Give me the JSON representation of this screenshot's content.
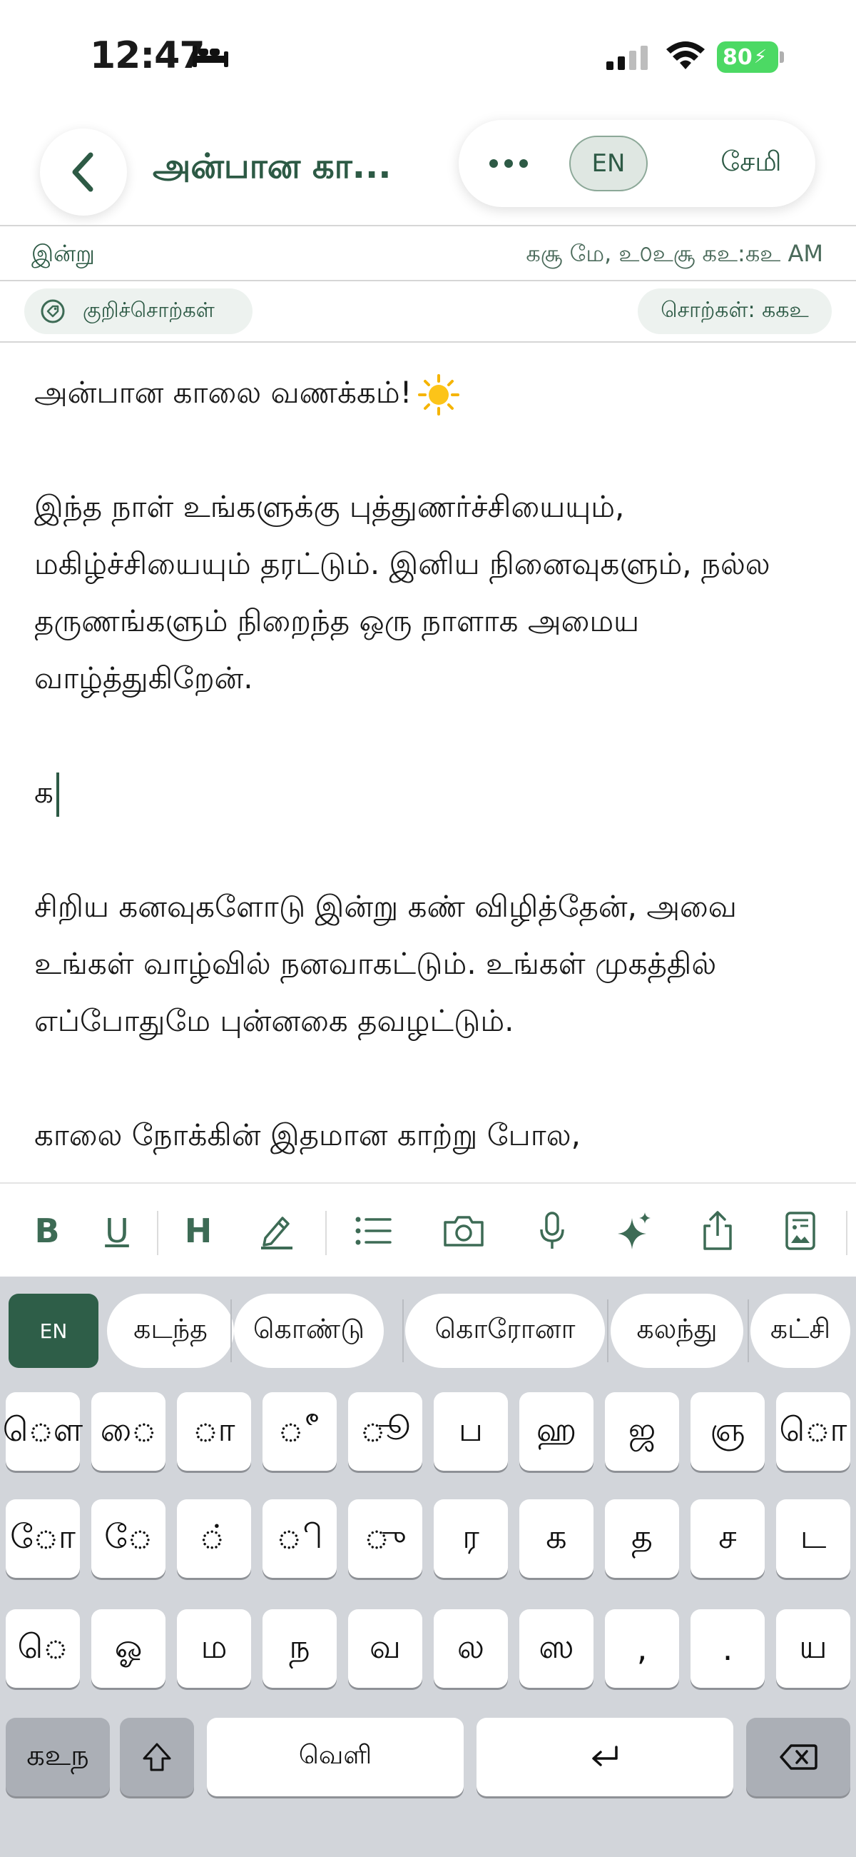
{
  "status_bar": {
    "time": "12:47",
    "battery": "80"
  },
  "nav": {
    "title": "அன்பான கா...",
    "lang": "EN",
    "save": "சேமி"
  },
  "meta": {
    "date_label": "இன்று",
    "datetime": "கசூ மே, உ௦உசூ கஉ:கஉ AM"
  },
  "tags": {
    "tag_label": "குறிச்சொற்கள்",
    "word_count": "சொற்கள்: ககஉ"
  },
  "editor": {
    "p1": "அன்பான காலை வணக்கம்!",
    "p2": "இந்த நாள் உங்களுக்கு புத்துணர்ச்சியையும், மகிழ்ச்சியையும் தரட்டும். இனிய நினைவுகளும், நல்ல தருணங்களும் நிறைந்த ஒரு நாளாக அமைய வாழ்த்துகிறேன்.",
    "p3": "க",
    "p4": "சிறிய கனவுகளோடு இன்று கண் விழித்தேன், அவை உங்கள் வாழ்வில் நனவாகட்டும். உங்கள் முகத்தில் எப்போதுமே புன்னகை தவழட்டும்.",
    "p5": "காலை நோக்கின் இதமான காற்று போல,"
  },
  "toolbar": {
    "bold": "B",
    "underline": "U",
    "heading": "H"
  },
  "keyboard": {
    "lang_key": "EN",
    "suggestions": [
      "கடந்த",
      "கொண்டு",
      "கொரோனா",
      "கலந்து",
      "கட்சி"
    ],
    "row1": [
      "ௌ",
      "ை",
      "ா",
      "ீ",
      "ூ",
      "ப",
      "ஹ",
      "ஜ",
      "ஞ",
      "ொ"
    ],
    "row2": [
      "ோ",
      "ே",
      "்",
      "ி",
      "ு",
      "ர",
      "க",
      "த",
      "ச",
      "ட"
    ],
    "row3": [
      "ெ",
      "ஓ",
      "ம",
      "ந",
      "வ",
      "ல",
      "ஸ",
      ",",
      ".",
      "ய"
    ],
    "numbers_key": "கஉந",
    "space": "வெளி"
  }
}
